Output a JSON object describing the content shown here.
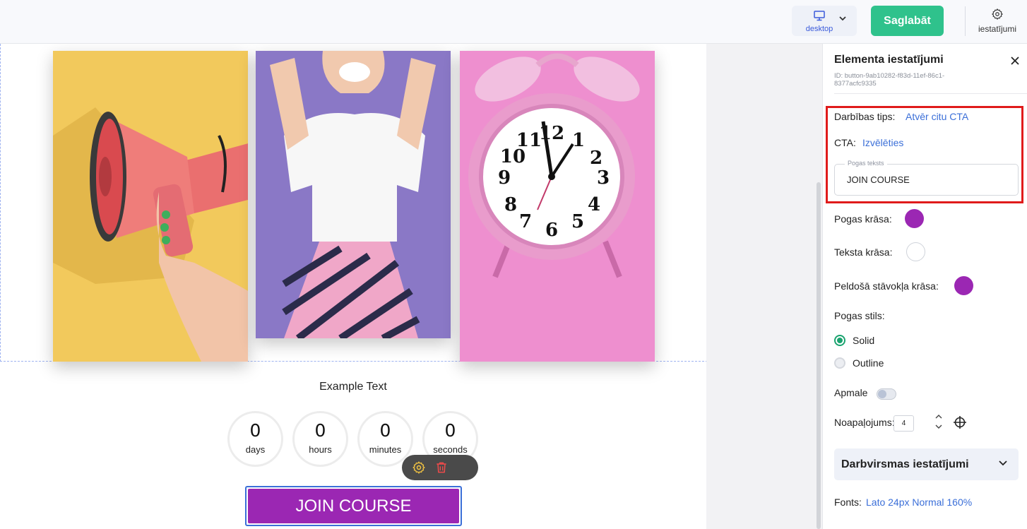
{
  "topbar": {
    "device_label": "desktop",
    "save_label": "Saglabāt",
    "settings_label": "iestatījumi"
  },
  "canvas": {
    "example_text": "Example Text",
    "countdown": [
      {
        "value": "0",
        "unit": "days"
      },
      {
        "value": "0",
        "unit": "hours"
      },
      {
        "value": "0",
        "unit": "minutes"
      },
      {
        "value": "0",
        "unit": "seconds"
      }
    ],
    "cta_button_label": "JOIN COURSE",
    "cta_button_color": "#9b27b3"
  },
  "sidebar": {
    "title": "Elementa iestatījumi",
    "element_id": "ID: button-9ab10282-f83d-11ef-86c1-8377acfc9335",
    "action_type_label": "Darbības tips:",
    "action_type_value": "Atvēr citu CTA",
    "cta_label": "CTA:",
    "cta_value": "Izvēlēties",
    "button_text_legend": "Pogas teksts",
    "button_text_value": "JOIN COURSE",
    "button_color_label": "Pogas krāsa:",
    "button_color": "#9b27b3",
    "text_color_label": "Teksta krāsa:",
    "text_color": "#ffffff",
    "hover_color_label": "Peldošā stāvokļa krāsa:",
    "hover_color": "#9b27b3",
    "button_style_label": "Pogas stils:",
    "style_options": [
      "Solid",
      "Outline"
    ],
    "style_selected": "Solid",
    "border_label": "Apmale",
    "border_enabled": false,
    "rounding_label": "Noapaļojums:",
    "rounding_value": "4",
    "accordion_title": "Darbvirsmas iestatījumi",
    "fonts_label": "Fonts:",
    "fonts_value": "Lato 24px Normal 160%"
  },
  "colors": {
    "accent_green": "#2fc28c",
    "link_blue": "#3b6fd8",
    "highlight_red": "#e01b1b"
  },
  "icons": {
    "device": "monitor-icon",
    "settings": "gear-icon",
    "close": "close-icon",
    "element_settings": "gear-icon",
    "delete": "trash-icon"
  }
}
